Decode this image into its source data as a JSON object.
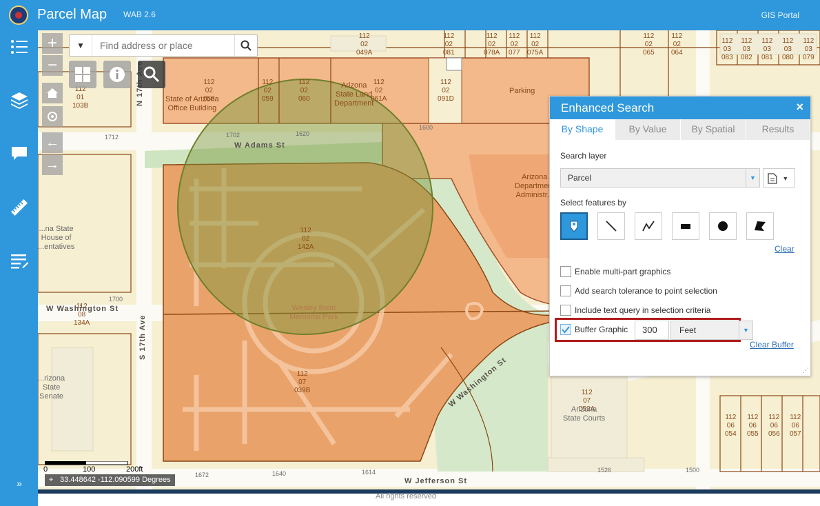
{
  "header": {
    "app_title": "Parcel Map",
    "subtitle": "WAB 2.6",
    "portal_link": "GIS Portal"
  },
  "sidebar": {
    "items": [
      "list-icon",
      "layers-icon",
      "comment-icon",
      "measure-icon",
      "edit-list-icon"
    ],
    "expand": "»"
  },
  "map_controls": {
    "zoom_in": "+",
    "zoom_out": "−",
    "home": "home-icon",
    "locate": "locate-icon",
    "back": "←",
    "forward": "→"
  },
  "search": {
    "placeholder": "Find address or place",
    "value": ""
  },
  "toolbar": [
    "basemap-icon",
    "info-icon",
    "search-tool-icon"
  ],
  "map": {
    "parcels": [
      {
        "text": "112\n02\n049A"
      },
      {
        "text": "112\n02\n081"
      },
      {
        "text": "112\n02\n078A"
      },
      {
        "text": "112\n02\n077"
      },
      {
        "text": "112\n02\n075A"
      },
      {
        "text": "112\n02\n065"
      },
      {
        "text": "112\n02\n064"
      },
      {
        "text": "112\n03\n083"
      },
      {
        "text": "112\n03\n082"
      },
      {
        "text": "112\n03\n081"
      },
      {
        "text": "112\n03\n080"
      },
      {
        "text": "112\n03\n079"
      },
      {
        "text": "112\n02\n058"
      },
      {
        "text": "112\n02\n059"
      },
      {
        "text": "112\n02\n060"
      },
      {
        "text": "112\n02\n061A"
      },
      {
        "text": "112\n02\n091D"
      },
      {
        "text": "112\n01\n103B"
      },
      {
        "text": "112\n02\n142A"
      },
      {
        "text": "112\n08\n134A"
      },
      {
        "text": "112\n07\n039B"
      },
      {
        "text": "112\n07\n052A"
      },
      {
        "text": "112\n06\n054"
      },
      {
        "text": "112\n06\n055"
      },
      {
        "text": "112\n06\n056"
      },
      {
        "text": "112\n06\n057"
      }
    ],
    "places": [
      {
        "text": "State of Arizona\nOffice Building"
      },
      {
        "text": "Arizona\nState Land\nDepartment"
      },
      {
        "text": "Parking"
      },
      {
        "text": "Arizona\nDepartment\nAdministr..."
      },
      {
        "text": "...na State\nHouse of\n...entatives"
      },
      {
        "text": "Wesley Bolin\nMemorial Park"
      },
      {
        "text": "Arizona\nState Courts"
      },
      {
        "text": "...rizona\nState\nSenate"
      }
    ],
    "streets": [
      "W Adams St",
      "N 17th Ave",
      "W Washington St",
      "S 17th Ave",
      "W Washington St",
      "W Jefferson St"
    ],
    "address_numbers": [
      "1712",
      "1702",
      "1620",
      "1600",
      "1700",
      "1672",
      "1640",
      "1614",
      "1526",
      "1500"
    ],
    "scale": {
      "labels": [
        "0",
        "100",
        "200ft"
      ]
    },
    "coordinates": "33.448642 -112.090599 Degrees",
    "attribution": "All rights reserved"
  },
  "panel": {
    "title": "Enhanced Search",
    "close": "×",
    "tabs": [
      "By Shape",
      "By Value",
      "By Spatial",
      "Results"
    ],
    "search_layer_label": "Search layer",
    "search_layer_value": "Parcel",
    "select_by_label": "Select features by",
    "shape_tools": [
      "point-icon",
      "line-icon",
      "polyline-icon",
      "rectangle-icon",
      "circle-icon",
      "polygon-icon"
    ],
    "clear": "Clear",
    "options": [
      {
        "label": "Enable multi-part graphics",
        "checked": false
      },
      {
        "label": "Add search tolerance to point selection",
        "checked": false
      },
      {
        "label": "Include text query in selection criteria",
        "checked": false
      },
      {
        "label": "Buffer Graphic",
        "checked": true
      }
    ],
    "buffer_distance": "300",
    "buffer_unit": "Feet",
    "clear_buffer": "Clear Buffer"
  }
}
